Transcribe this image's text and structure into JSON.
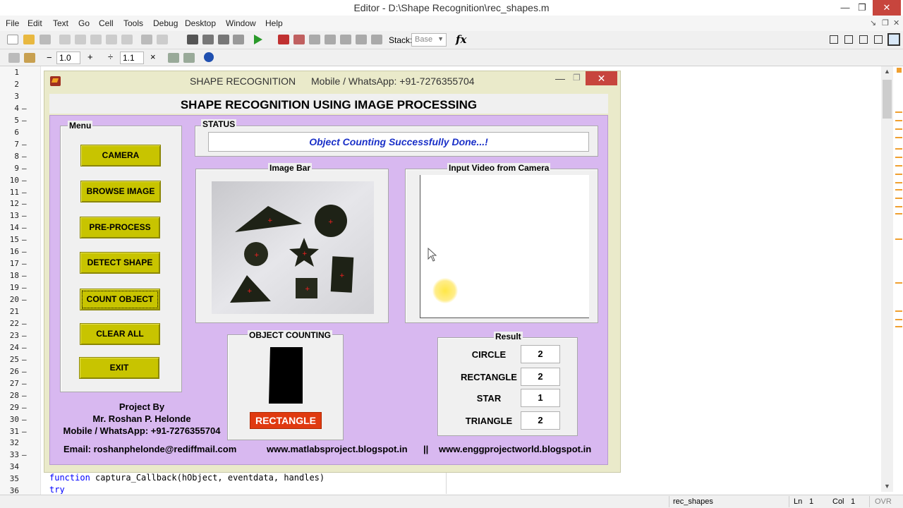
{
  "editor": {
    "title": "Editor - D:\\Shape Recognition\\rec_shapes.m",
    "menu": [
      "File",
      "Edit",
      "Text",
      "Go",
      "Cell",
      "Tools",
      "Debug",
      "Desktop",
      "Window",
      "Help"
    ],
    "stack_label": "Stack:",
    "stack_value": "Base",
    "fx_label": "fx",
    "cell_minus": "−",
    "cell_value1": "1.0",
    "cell_plus": "+",
    "cell_divide": "÷",
    "cell_value2": "1.1",
    "cell_times": "×",
    "line_numbers": [
      "1",
      "2",
      "3",
      "4",
      "5",
      "6",
      "7",
      "8",
      "9",
      "10",
      "11",
      "12",
      "13",
      "14",
      "15",
      "16",
      "17",
      "18",
      "19",
      "20",
      "21",
      "22",
      "23",
      "24",
      "25",
      "26",
      "27",
      "28",
      "29",
      "30",
      "31",
      "32",
      "33",
      "34",
      "35",
      "36"
    ],
    "code_line_35": {
      "keyword": "function",
      "rest": " captura_Callback(hObject, eventdata, handles)"
    },
    "code_line_36": {
      "keyword": "try",
      "rest": ""
    },
    "statusbar": {
      "file": "rec_shapes",
      "ln_label": "Ln",
      "ln_value": "1",
      "col_label": "Col",
      "col_value": "1",
      "ovr": "OVR"
    }
  },
  "gui": {
    "window_title": "SHAPE RECOGNITION",
    "window_contact": "Mobile / WhatsApp: +91-7276355704",
    "heading": "SHAPE RECOGNITION USING IMAGE PROCESSING",
    "menu_panel_title": "Menu",
    "buttons": [
      "CAMERA",
      "BROWSE IMAGE",
      "PRE-PROCESS",
      "DETECT SHAPE",
      "COUNT OBJECT",
      "CLEAR ALL",
      "EXIT"
    ],
    "status_panel_title": "STATUS",
    "status_message": "Object Counting Successfully Done...!",
    "image_bar_title": "Image Bar",
    "video_panel_title": "Input Video from Camera",
    "object_counting_title": "OBJECT COUNTING",
    "detected_shape_label": "RECTANGLE",
    "result_panel_title": "Result",
    "results": [
      {
        "label": "CIRCLE",
        "value": "2"
      },
      {
        "label": "RECTANGLE",
        "value": "2"
      },
      {
        "label": "STAR",
        "value": "1"
      },
      {
        "label": "TRIANGLE",
        "value": "2"
      }
    ],
    "credits": [
      "Project By",
      "Mr. Roshan P. Helonde",
      "Mobile / WhatsApp: +91-7276355704"
    ],
    "footer": {
      "email": "Email: roshanphelonde@rediffmail.com",
      "site1": "www.matlabsproject.blogspot.in",
      "separator": "||",
      "site2": "www.enggprojectworld.blogspot.in"
    },
    "colors": {
      "button": "#c8c400",
      "panel_bg": "#d8b8f0",
      "status_text": "#1a30c8",
      "shape_label": "#e03a10"
    }
  }
}
